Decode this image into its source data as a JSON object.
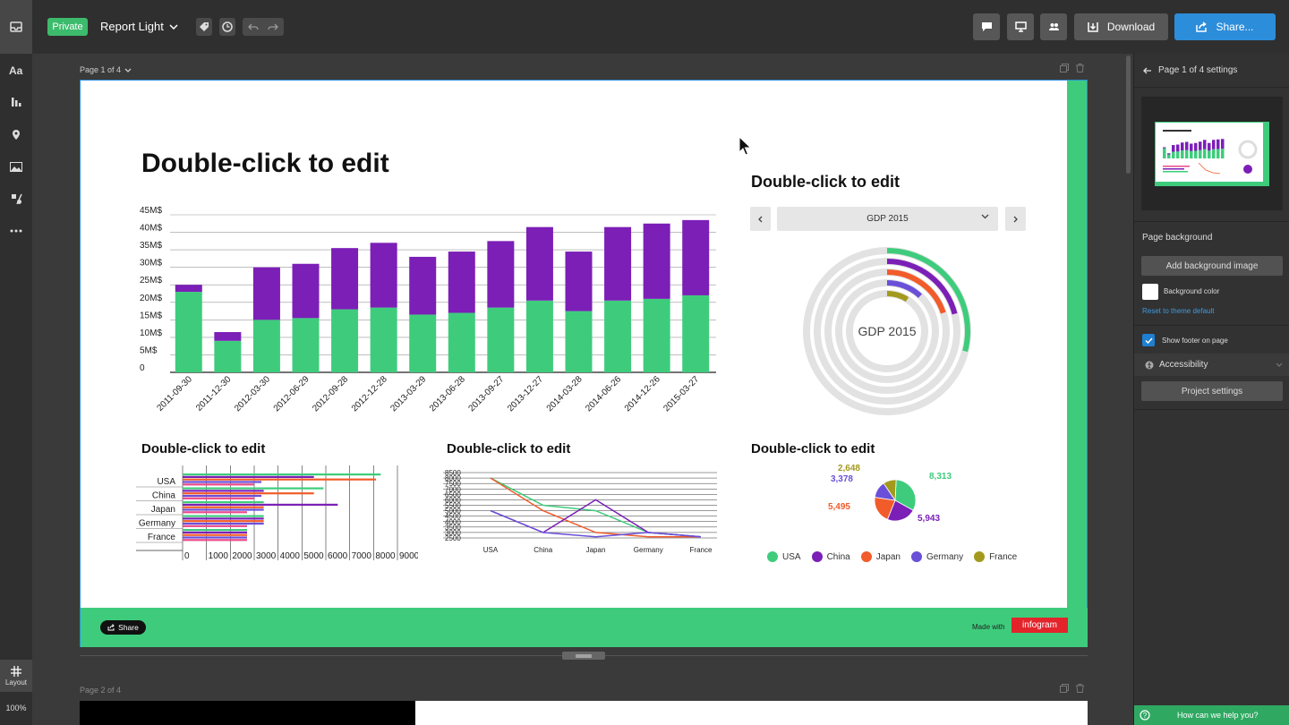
{
  "topbar": {
    "private_label": "Private",
    "report_name": "Report Light",
    "download_label": "Download",
    "share_label": "Share..."
  },
  "leftrail": {
    "items": [
      "text-icon",
      "chart-icon",
      "map-icon",
      "image-icon",
      "shapes-icon",
      "more-icon"
    ],
    "layout_label": "Layout",
    "zoom": "100%"
  },
  "canvas": {
    "page1_label": "Page 1 of 4",
    "page2_label": "Page 2 of 4",
    "main_title": "Double-click to edit",
    "donut_title": "Double-click to edit",
    "hbar_title": "Double-click to edit",
    "line_title": "Double-click to edit",
    "pie_title": "Double-click to edit",
    "gdp_select": "GDP 2015",
    "donut_center": "GDP 2015",
    "footer_share": "Share",
    "made_with": "Made with",
    "brand": "infogram"
  },
  "chart_data": [
    {
      "type": "bar",
      "stacked": true,
      "categories": [
        "2011-09-30",
        "2011-12-30",
        "2012-03-30",
        "2012-06-29",
        "2012-09-28",
        "2012-12-28",
        "2013-03-29",
        "2013-06-28",
        "2013-09-27",
        "2013-12-27",
        "2014-03-28",
        "2014-06-26",
        "2014-12-26",
        "2015-03-27"
      ],
      "series": [
        {
          "color": "#3ecc7c",
          "values": [
            23,
            9,
            15,
            15.5,
            18,
            18.5,
            16.5,
            17,
            18.5,
            20.5,
            17.5,
            20.5,
            21,
            22
          ]
        },
        {
          "color": "#7b1fb7",
          "values": [
            2,
            2.5,
            15,
            15.5,
            17.5,
            18.5,
            16.5,
            17.5,
            19,
            21,
            17,
            21,
            21.5,
            21.5
          ]
        }
      ],
      "y_ticks": [
        "0",
        "5M$",
        "10M$",
        "15M$",
        "20M$",
        "25M$",
        "30M$",
        "35M$",
        "40M$",
        "45M$"
      ],
      "ylim": [
        0,
        45
      ]
    },
    {
      "type": "pie",
      "variant": "concentric-rings",
      "center_label": "GDP 2015",
      "rings": [
        {
          "color": "#3ecc7c",
          "value": 0.29
        },
        {
          "color": "#7b1fb7",
          "value": 0.21
        },
        {
          "color": "#f25b2a",
          "value": 0.2
        },
        {
          "color": "#6a4fd9",
          "value": 0.12
        },
        {
          "color": "#a39a1d",
          "value": 0.09
        }
      ]
    },
    {
      "type": "bar",
      "orientation": "horizontal",
      "categories": [
        "USA",
        "China",
        "Japan",
        "Germany",
        "France"
      ],
      "x_ticks": [
        "0",
        "1000",
        "2000",
        "3000",
        "4000",
        "5000",
        "6000",
        "7000",
        "8000",
        "9000"
      ],
      "series_colors": [
        "#3ecc7c",
        "#7b1fb7",
        "#f25b2a",
        "#6a4fd9",
        "#e84a8a"
      ],
      "values": [
        [
          8300,
          5500,
          8100,
          3300,
          3000
        ],
        [
          5900,
          3400,
          5500,
          3300,
          3000
        ],
        [
          3400,
          6500,
          3400,
          3400,
          2700
        ],
        [
          3400,
          3400,
          3400,
          3400,
          2700
        ],
        [
          2700,
          2700,
          2700,
          2700,
          2700
        ]
      ],
      "xlim": [
        0,
        9000
      ]
    },
    {
      "type": "line",
      "x": [
        "USA",
        "China",
        "Japan",
        "Germany",
        "France"
      ],
      "y_ticks": [
        "2500",
        "3000",
        "3500",
        "4000",
        "4500",
        "5000",
        "5500",
        "6000",
        "6500",
        "7000",
        "7500",
        "8000",
        "8500"
      ],
      "ylim": [
        2500,
        8500
      ],
      "series": [
        {
          "color": "#3ecc7c",
          "values": [
            8000,
            5500,
            5000,
            3000,
            2600
          ]
        },
        {
          "color": "#f25b2a",
          "values": [
            8000,
            5000,
            3000,
            2600,
            2600
          ]
        },
        {
          "color": "#7b1fb7",
          "values": [
            5000,
            3000,
            6000,
            3000,
            2600
          ]
        },
        {
          "color": "#6a4fd9",
          "values": [
            5000,
            3000,
            2600,
            3000,
            2600
          ]
        }
      ]
    },
    {
      "type": "pie",
      "slices": [
        {
          "name": "USA",
          "value": 8313,
          "label": "8,313",
          "color": "#3ecc7c"
        },
        {
          "name": "China",
          "value": 5943,
          "label": "5,943",
          "color": "#7b1fb7"
        },
        {
          "name": "Japan",
          "value": 5495,
          "label": "5,495",
          "color": "#f25b2a"
        },
        {
          "name": "Germany",
          "value": 3378,
          "label": "3,378",
          "color": "#6a4fd9"
        },
        {
          "name": "France",
          "value": 2648,
          "label": "2,648",
          "color": "#a39a1d"
        }
      ],
      "legend": [
        "USA",
        "China",
        "Japan",
        "Germany",
        "France"
      ]
    }
  ],
  "rpanel": {
    "header": "Page 1 of 4 settings",
    "page_background": "Page background",
    "add_bg_image": "Add background image",
    "bg_color_label": "Background color",
    "reset_link": "Reset to theme default",
    "show_footer": "Show footer on page",
    "accessibility": "Accessibility",
    "project_settings": "Project settings",
    "help": "How can we help you?"
  }
}
